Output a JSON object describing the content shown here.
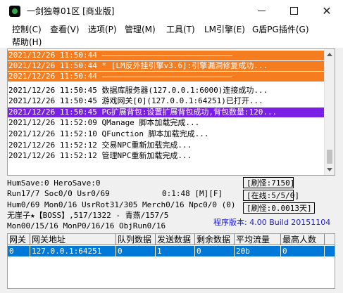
{
  "window": {
    "title": "一剑独尊01区 [商业版]",
    "minimize_glyph": "—",
    "close_glyph": "✕"
  },
  "menu": {
    "row1": [
      "控制(C)",
      "查看(V)",
      "选项(P)",
      "管理(M)",
      "工具(T)",
      "LM引擎(E)",
      "G盾PG插件(G)"
    ],
    "row2": [
      "帮助(H)"
    ]
  },
  "log": {
    "lines": [
      {
        "text": "2021/12/26 11:50:44 ————————————————————————————",
        "style": "orange"
      },
      {
        "text": "2021/12/26 11:50:44 * [LM反外挂引擎v3.6]:引擎漏洞修复成功...",
        "style": "orange"
      },
      {
        "text": "2021/12/26 11:50:44 ————————————————————————————",
        "style": "orange"
      },
      {
        "text": "2021/12/26 11:50:45 数据库服务器(127.0.0.1:6000)连接成功...",
        "style": "normal"
      },
      {
        "text": "2021/12/26 11:50:45 游戏网关[0](127.0.0.1:64251)已打开...",
        "style": "normal"
      },
      {
        "text": "2021/12/26 11:50:45 PG扩展背包:设置扩展背包成功,背包数量:120...",
        "style": "purple"
      },
      {
        "text": "2021/12/26 11:52:09 QManage 脚本加载完成...",
        "style": "normal"
      },
      {
        "text": "2021/12/26 11:52:10 QFunction 脚本加载完成...",
        "style": "normal"
      },
      {
        "text": "2021/12/26 11:52:12 交易NPC重新加载完成...",
        "style": "normal"
      },
      {
        "text": "2021/12/26 11:52:12 管理NPC重新加载完成...",
        "style": "normal"
      }
    ]
  },
  "status": {
    "line1": "HumSave:0 HeroSave:0",
    "line2_left": "Run17/7 Soc0/0 Usr0/69",
    "line2_mid": "0:1:48 [M][F]",
    "line3": "Hum0/69 Mon0/16 UsrRot31/305 Merch0/16 Npc0/0 (0)",
    "line4": "无崖子★【BOSS】,517/1322 - 青燕/157/5",
    "line5": "Mon00/15/16 MonP0/16/16 ObjRun0/16",
    "refresh": "[刷怪:7150]",
    "online": "[在线:5/5/0]",
    "refresh_rate": "[刷怪:0.0013天]",
    "version": "程序版本: 4.00 Build 20151104"
  },
  "gateway_table": {
    "columns": [
      "网关",
      "网关地址",
      "队列数据",
      "发送数据",
      "剩余数据",
      "平均流量",
      "最高人数"
    ],
    "rows": [
      [
        "0",
        "127.0.0.1:64251",
        "0",
        "1",
        "0",
        "20b",
        "0"
      ]
    ]
  }
}
